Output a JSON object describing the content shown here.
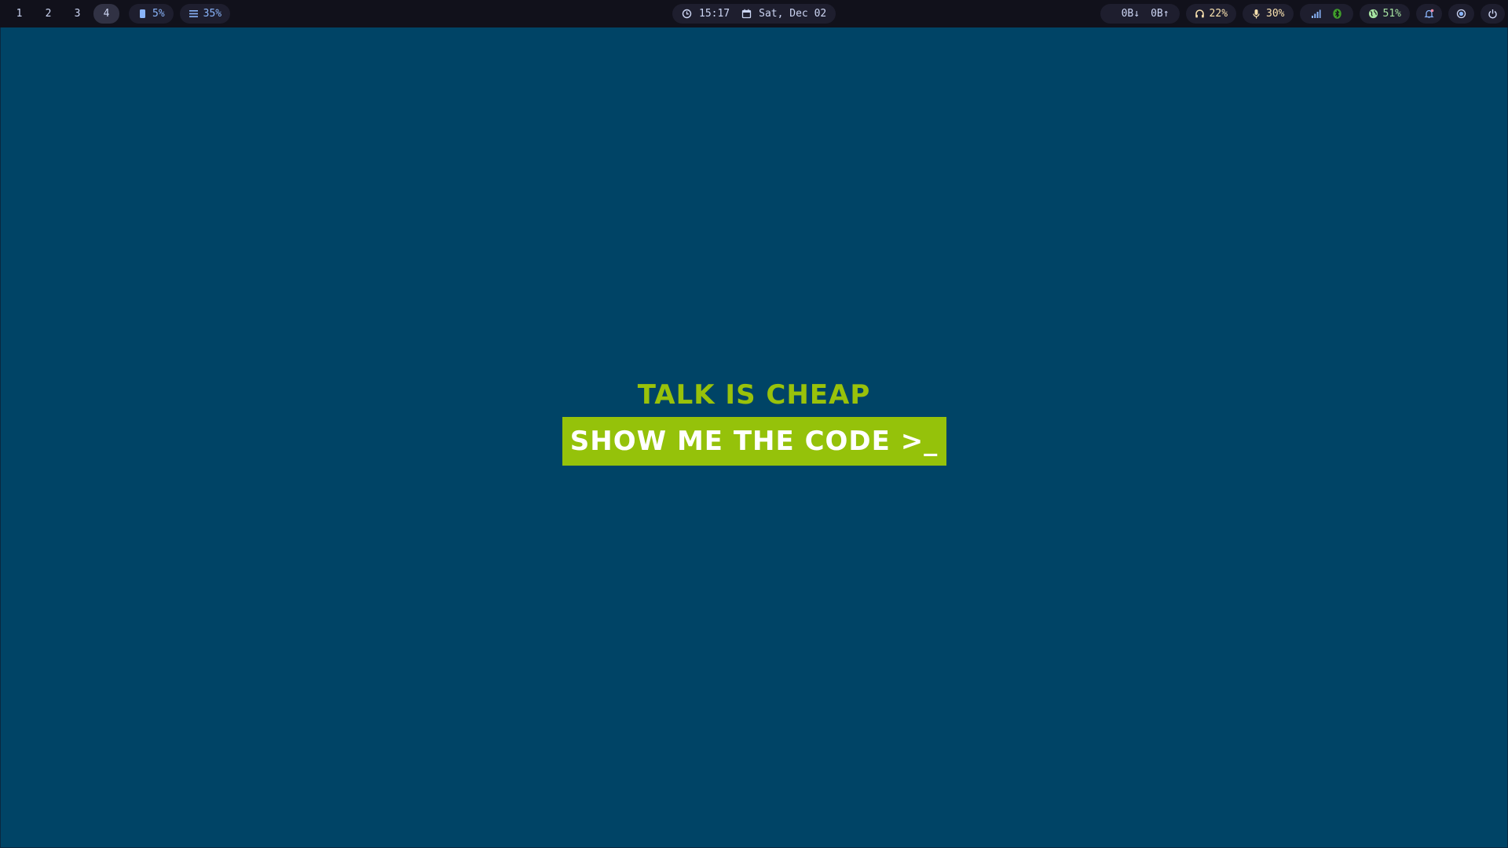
{
  "workspaces": [
    {
      "label": "1",
      "active": false
    },
    {
      "label": "2",
      "active": false
    },
    {
      "label": "3",
      "active": false
    },
    {
      "label": "4",
      "active": true
    }
  ],
  "system": {
    "storage_percent": "5%",
    "memory_percent": "35%"
  },
  "clock": {
    "time": "15:17",
    "date": "Sat, Dec 02"
  },
  "network": {
    "down": "0B",
    "up": "0B"
  },
  "audio": {
    "headphone_volume": "22%",
    "mic_volume": "30%"
  },
  "connectivity": {
    "signal_icon": "signal-icon",
    "bluetooth_icon": "bluetooth-icon"
  },
  "battery": {
    "percent": "51%"
  },
  "wallpaper": {
    "line1": "TALK IS CHEAP",
    "line2": "SHOW ME THE CODE >_"
  },
  "colors": {
    "background": "#004466",
    "bar": "#11111b",
    "accent_green": "#95c20a"
  }
}
